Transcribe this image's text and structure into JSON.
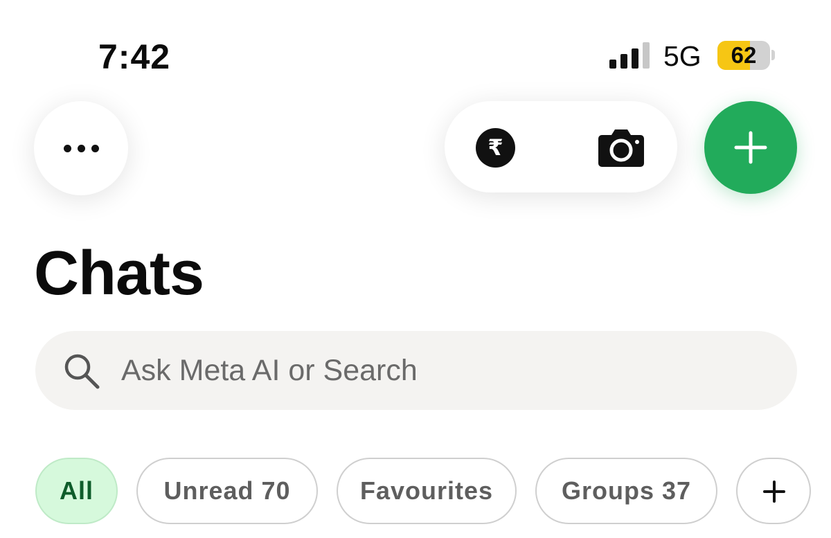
{
  "status_bar": {
    "time": "7:42",
    "network": "5G",
    "battery_level": "62",
    "signal_strength_bars": 3,
    "signal_total_bars": 4,
    "battery_fill_percent": 62,
    "battery_color": "#f6c614"
  },
  "toolbar": {
    "more_icon": "more-horizontal-icon",
    "payment_icon": "rupee-icon",
    "payment_symbol": "₹",
    "camera_icon": "camera-icon",
    "new_chat_icon": "plus-icon",
    "accent_color": "#22ab5b"
  },
  "header": {
    "title": "Chats"
  },
  "search": {
    "placeholder": "Ask Meta AI or Search",
    "value": "",
    "icon": "search-icon"
  },
  "filters": {
    "selected": "All",
    "items": [
      {
        "label": "All",
        "active": true
      },
      {
        "label": "Unread 70",
        "active": false
      },
      {
        "label": "Favourites",
        "active": false
      },
      {
        "label": "Groups 37",
        "active": false
      }
    ],
    "add_icon": "plus-icon",
    "active_background": "#d6f9dc",
    "active_text": "#0e5c2a"
  }
}
